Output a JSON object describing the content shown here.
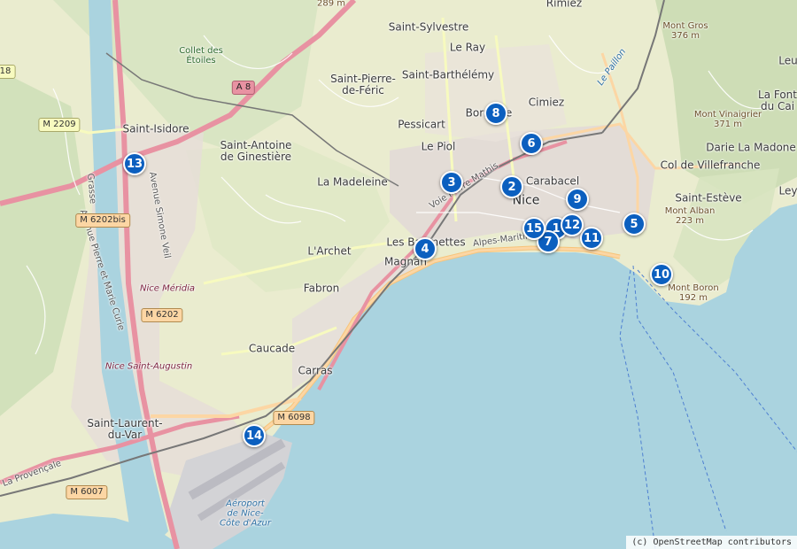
{
  "map": {
    "places": [
      {
        "id": "saint-sylvestre",
        "text": "Saint-Sylvestre",
        "cls": "big"
      },
      {
        "id": "le-ray",
        "text": "Le Ray",
        "cls": "big"
      },
      {
        "id": "rimiez",
        "text": "Rimiez",
        "cls": "big"
      },
      {
        "id": "saint-barthelemy",
        "text": "Saint-Barthélémy",
        "cls": "big"
      },
      {
        "id": "saint-pierre-de-feric",
        "text": "Saint-Pierre-\nde-Féric",
        "cls": "big"
      },
      {
        "id": "bornala",
        "text": "Borniolle",
        "cls": "big"
      },
      {
        "id": "cimiez",
        "text": "Cimiez",
        "cls": "big"
      },
      {
        "id": "pessicart",
        "text": "Pessicart",
        "cls": "big"
      },
      {
        "id": "le-piol",
        "text": "Le Piol",
        "cls": "big"
      },
      {
        "id": "saint-isidore",
        "text": "Saint-Isidore",
        "cls": "big"
      },
      {
        "id": "saint-antoine",
        "text": "Saint-Antoine\nde Ginestière",
        "cls": "big"
      },
      {
        "id": "la-madeleine",
        "text": "La Madeleine",
        "cls": "big"
      },
      {
        "id": "carabacel",
        "text": "Carabacel",
        "cls": "big"
      },
      {
        "id": "nice",
        "text": "Nice",
        "cls": "big"
      },
      {
        "id": "les-baumettes",
        "text": "Les Baumettes",
        "cls": "big"
      },
      {
        "id": "magnan",
        "text": "Magnan",
        "cls": "big"
      },
      {
        "id": "larchet",
        "text": "L'Archet",
        "cls": "big"
      },
      {
        "id": "fabron",
        "text": "Fabron",
        "cls": "big"
      },
      {
        "id": "caucade",
        "text": "Caucade",
        "cls": "big"
      },
      {
        "id": "carras",
        "text": "Carras",
        "cls": "big"
      },
      {
        "id": "saint-laurent",
        "text": "Saint-Laurent-\ndu-Var",
        "cls": "big"
      },
      {
        "id": "col-de-villefranche",
        "text": "Col de Villefranche",
        "cls": "big"
      },
      {
        "id": "saint-esteve",
        "text": "Saint-Estève",
        "cls": "big"
      },
      {
        "id": "darie",
        "text": "Darie La Madone",
        "cls": "big"
      },
      {
        "id": "la-fontaine",
        "text": "La Font\ndu Cai",
        "cls": "big"
      },
      {
        "id": "collet",
        "text": "Collet des\nÉtoiles",
        "cls": "park"
      },
      {
        "id": "mont-gros",
        "text": "Mont Gros\n376 m",
        "cls": "peak"
      },
      {
        "id": "mont-vinaigrier",
        "text": "Mont Vinaigrier\n371 m",
        "cls": "peak"
      },
      {
        "id": "mont-alban",
        "text": "Mont Alban\n223 m",
        "cls": "peak"
      },
      {
        "id": "mont-boron",
        "text": "Mont Boron\n192 m",
        "cls": "peak"
      },
      {
        "id": "nice-meridia",
        "text": "Nice Méridia",
        "cls": "station"
      },
      {
        "id": "nice-saint-augustin",
        "text": "Nice Saint-Augustin",
        "cls": "station"
      },
      {
        "id": "aeroport",
        "text": "Aéroport\nde Nice-\nCôte d'Azur",
        "cls": "water"
      },
      {
        "id": "la-provencale",
        "text": "La Provençale",
        "cls": "small"
      },
      {
        "id": "le-paillon",
        "text": "Le Paillon",
        "cls": "water"
      },
      {
        "id": "grasse",
        "text": "Grasse",
        "cls": "small"
      },
      {
        "id": "alpes-maritimes",
        "text": "Alpes-Maritimes",
        "cls": "small"
      },
      {
        "id": "voie-pierre-mathis",
        "text": "Voie Pierre Mathis",
        "cls": "small"
      },
      {
        "id": "avenue-simone-veil",
        "text": "Avenue Simone Veil",
        "cls": "small"
      },
      {
        "id": "avenue-pierre-marie-curie",
        "text": "Avenue Pierre et Marie Curie",
        "cls": "small"
      },
      {
        "id": "altitude-289",
        "text": "289 m",
        "cls": "peak"
      },
      {
        "id": "leu",
        "text": "Leu",
        "cls": "big"
      },
      {
        "id": "eze",
        "text": "Ley",
        "cls": "big"
      }
    ],
    "roads": [
      {
        "id": "a8",
        "text": "A 8",
        "cls": "motorway"
      },
      {
        "id": "m2209",
        "text": "M 2209",
        "cls": "secondary"
      },
      {
        "id": "m6202bis",
        "text": "M 6202bis",
        "cls": "primary"
      },
      {
        "id": "m6202",
        "text": "M 6202",
        "cls": "primary"
      },
      {
        "id": "m6098",
        "text": "M 6098",
        "cls": "primary"
      },
      {
        "id": "m6007",
        "text": "M 6007",
        "cls": "primary"
      },
      {
        "id": "r18",
        "text": "18",
        "cls": "secondary"
      }
    ],
    "markers": [
      {
        "id": "1",
        "label": "1"
      },
      {
        "id": "2",
        "label": "2"
      },
      {
        "id": "3",
        "label": "3"
      },
      {
        "id": "4",
        "label": "4"
      },
      {
        "id": "5",
        "label": "5"
      },
      {
        "id": "6",
        "label": "6"
      },
      {
        "id": "7",
        "label": "7"
      },
      {
        "id": "8",
        "label": "8"
      },
      {
        "id": "9",
        "label": "9"
      },
      {
        "id": "10",
        "label": "10"
      },
      {
        "id": "11",
        "label": "11"
      },
      {
        "id": "12",
        "label": "12"
      },
      {
        "id": "13",
        "label": "13"
      },
      {
        "id": "14",
        "label": "14"
      },
      {
        "id": "15",
        "label": "15"
      }
    ],
    "attribution": "(c) OpenStreetMap contributors"
  }
}
